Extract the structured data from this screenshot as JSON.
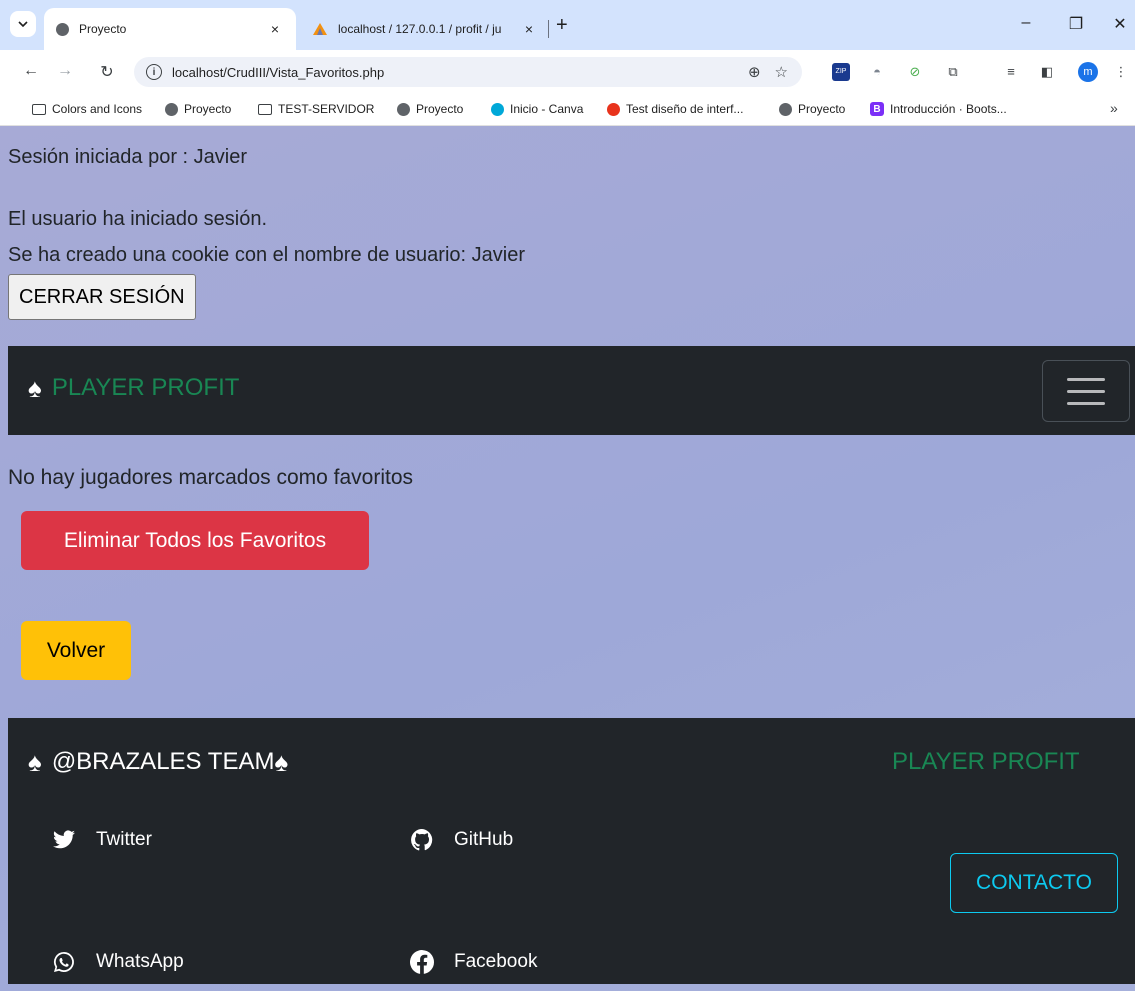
{
  "browser": {
    "tabs": [
      {
        "label": "Proyecto",
        "active": true
      },
      {
        "label": "localhost / 127.0.0.1 / profit / ju",
        "active": false
      }
    ],
    "new_tab": "+",
    "close_glyph": "×",
    "url": "localhost/CrudIII/Vista_Favoritos.php",
    "profile_initial": "m",
    "bookmarks": [
      {
        "label": "Colors and Icons",
        "icon": "folder-icon"
      },
      {
        "label": "Proyecto",
        "icon": "globe-icon"
      },
      {
        "label": "TEST-SERVIDOR",
        "icon": "folder-icon"
      },
      {
        "label": "Proyecto",
        "icon": "globe-icon"
      },
      {
        "label": "Inicio - Canva",
        "icon": "canva-icon"
      },
      {
        "label": "Test diseño de interf...",
        "icon": "figma-icon"
      },
      {
        "label": "Proyecto",
        "icon": "globe-icon"
      },
      {
        "label": "Introducción · Boots...",
        "icon": "bootstrap-icon"
      }
    ],
    "bookmark_more": "»"
  },
  "session": {
    "started_by": "Sesión iniciada por : Javier",
    "logged_in": "El usuario ha iniciado sesión.",
    "cookie": "Se ha creado una cookie con el nombre de usuario: Javier",
    "logout_label": "CERRAR SESIÓN"
  },
  "navbar": {
    "spade": "♠",
    "brand": "PLAYER PROFIT"
  },
  "main": {
    "empty_message": "No hay jugadores marcados como favoritos",
    "delete_all_label": "Eliminar Todos los Favoritos",
    "back_label": "Volver"
  },
  "footer": {
    "team": "@BRAZALES TEAM",
    "spade": "♠",
    "brand": "PLAYER PROFIT",
    "social": {
      "twitter": "Twitter",
      "github": "GitHub",
      "whatsapp": "WhatsApp",
      "facebook": "Facebook"
    },
    "contact_label": "CONTACTO"
  },
  "colors": {
    "page_bg": "#a3aad8",
    "navbar_bg": "#212529",
    "brand_green": "#198754",
    "danger": "#dc3545",
    "warning": "#ffc107",
    "info": "#0dcaf0"
  }
}
